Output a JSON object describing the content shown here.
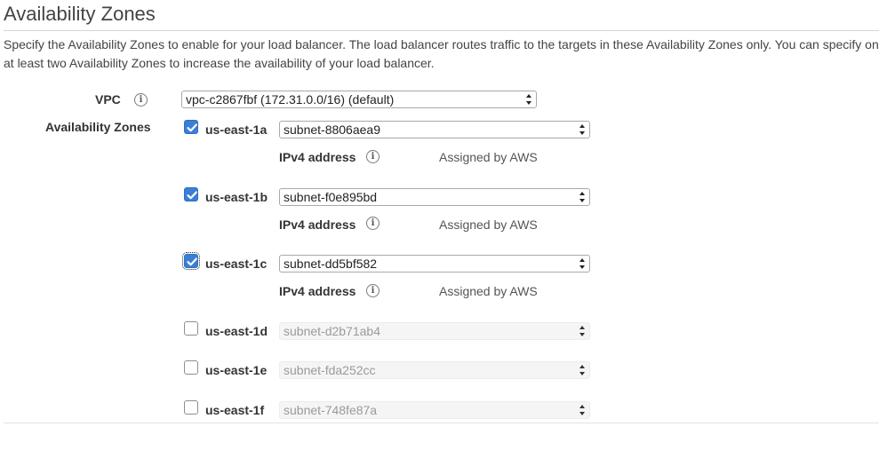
{
  "section": {
    "title": "Availability Zones",
    "description_line1": "Specify the Availability Zones to enable for your load balancer. The load balancer routes traffic to the targets in these Availability Zones only. You can specify on",
    "description_line2": "at least two Availability Zones to increase the availability of your load balancer."
  },
  "vpc": {
    "label": "VPC",
    "selected": "vpc-c2867fbf (172.31.0.0/16) (default)",
    "info_icon": "info-icon"
  },
  "availability_zones_label": "Availability Zones",
  "zones": [
    {
      "name": "us-east-1a",
      "checked": true,
      "subnet": "subnet-8806aea9",
      "ipv4_label": "IPv4 address",
      "ipv4_value": "Assigned by AWS"
    },
    {
      "name": "us-east-1b",
      "checked": true,
      "subnet": "subnet-f0e895bd",
      "ipv4_label": "IPv4 address",
      "ipv4_value": "Assigned by AWS"
    },
    {
      "name": "us-east-1c",
      "checked": true,
      "subnet": "subnet-dd5bf582",
      "ipv4_label": "IPv4 address",
      "ipv4_value": "Assigned by AWS"
    },
    {
      "name": "us-east-1d",
      "checked": false,
      "subnet": "subnet-d2b71ab4"
    },
    {
      "name": "us-east-1e",
      "checked": false,
      "subnet": "subnet-fda252cc"
    },
    {
      "name": "us-east-1f",
      "checked": false,
      "subnet": "subnet-748fe87a"
    }
  ],
  "colors": {
    "checkbox_checked": "#3a7fd5",
    "text": "#333333",
    "disabled_text": "#9a9a9a"
  }
}
